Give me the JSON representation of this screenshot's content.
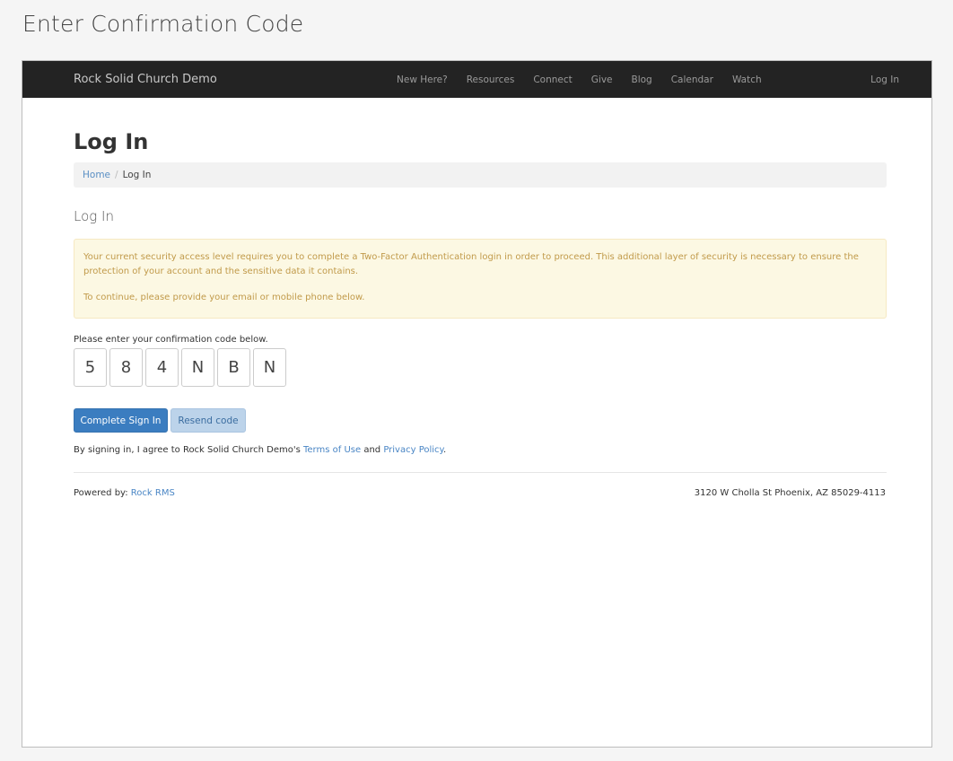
{
  "caption": "Enter Confirmation Code",
  "navbar": {
    "brand": "Rock Solid Church Demo",
    "items": [
      "New Here?",
      "Resources",
      "Connect",
      "Give",
      "Blog",
      "Calendar",
      "Watch"
    ],
    "login": "Log In"
  },
  "page": {
    "title": "Log In",
    "breadcrumb": {
      "home": "Home",
      "separator": "/",
      "current": "Log In"
    },
    "section_title": "Log In"
  },
  "alert": {
    "line1": "Your current security access level requires you to complete a Two-Factor Authentication login in order to proceed. This additional layer of security is necessary to ensure the protection of your account and the sensitive data it contains.",
    "line2": "To continue, please provide your email or mobile phone below."
  },
  "code": {
    "prompt": "Please enter your confirmation code below.",
    "digits": [
      "5",
      "8",
      "4",
      "N",
      "B",
      "N"
    ]
  },
  "buttons": {
    "complete": "Complete Sign In",
    "resend": "Resend code"
  },
  "agreement": {
    "prefix": "By signing in, I agree to Rock Solid Church Demo's ",
    "terms": "Terms of Use",
    "and": " and ",
    "privacy": "Privacy Policy",
    "suffix": "."
  },
  "footer": {
    "powered_prefix": "Powered by: ",
    "powered_link": "Rock RMS",
    "address": "3120 W Cholla St Phoenix, AZ 85029-4113"
  },
  "colors": {
    "navbar_bg": "#232323",
    "primary": "#3b7dc0",
    "alert_bg": "#fcf8e3",
    "alert_text": "#c19a4a",
    "link": "#4a86c5"
  }
}
